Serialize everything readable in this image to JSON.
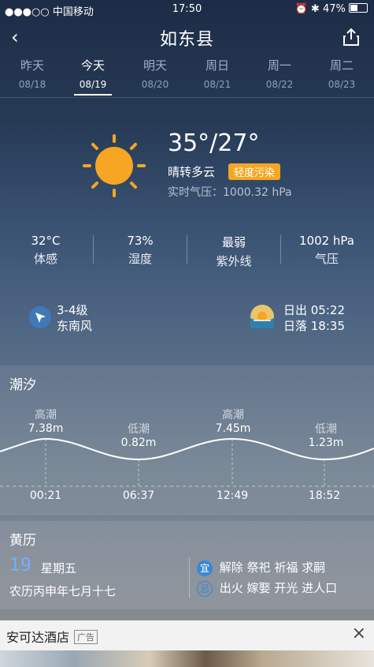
{
  "status_bar": {
    "carrier": "●●●○○ 中国移动",
    "time": "17:50",
    "battery": "47%"
  },
  "header": {
    "title": "如东县"
  },
  "tabs": [
    {
      "day": "昨天",
      "date": "08/18"
    },
    {
      "day": "今天",
      "date": "08/19",
      "active": true
    },
    {
      "day": "明天",
      "date": "08/20"
    },
    {
      "day": "周日",
      "date": "08/21"
    },
    {
      "day": "周一",
      "date": "08/22"
    },
    {
      "day": "周二",
      "date": "08/23"
    }
  ],
  "current": {
    "temp_range": "35°/27°",
    "condition": "晴转多云",
    "pollution_badge": "轻度污染",
    "pressure_line": "实时气压：1000.32 hPa"
  },
  "stats": [
    {
      "value": "32°C",
      "label": "体感"
    },
    {
      "value": "73%",
      "label": "湿度"
    },
    {
      "value": "最弱",
      "label": "紫外线"
    },
    {
      "value": "1002 hPa",
      "label": "气压"
    }
  ],
  "wind": {
    "level": "3-4级",
    "direction": "东南风"
  },
  "sun": {
    "sunrise": "日出 05:22",
    "sunset": "日落 18:35"
  },
  "tide": {
    "title": "潮汐",
    "points": [
      {
        "type": "高潮",
        "height": "7.38m",
        "time": "00:21"
      },
      {
        "type": "低潮",
        "height": "0.82m",
        "time": "06:37"
      },
      {
        "type": "高潮",
        "height": "7.45m",
        "time": "12:49"
      },
      {
        "type": "低潮",
        "height": "1.23m",
        "time": "18:52"
      }
    ]
  },
  "almanac": {
    "title": "黄历",
    "day_number": "19",
    "weekday": "星期五",
    "lunar_date": "农历丙申年七月十七",
    "yi_label": "宜",
    "yi_items": "解除 祭祀 祈福 求嗣",
    "ji_label": "忌",
    "ji_items": "出火 嫁娶 开光 进人口"
  },
  "ad": {
    "title": "安可达酒店",
    "badge": "广告"
  },
  "colors": {
    "badge": "#f5a623",
    "sun": "#f6a623",
    "yi": "#3a86d6"
  }
}
